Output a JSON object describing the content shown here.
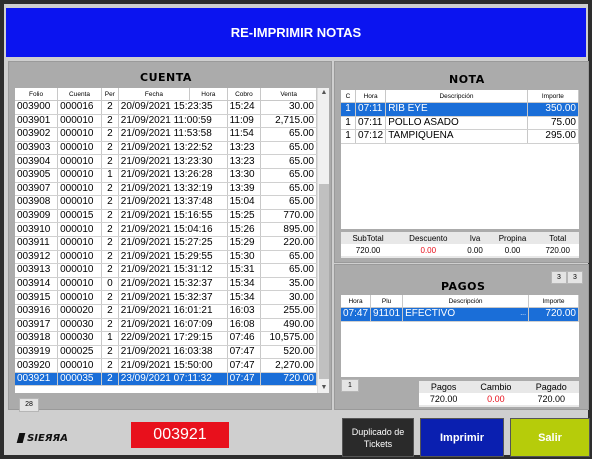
{
  "window": {
    "title": "RE-IMPRIMIR NOTAS"
  },
  "cuenta": {
    "title": "CUENTA",
    "columns": [
      "Folio",
      "Cuenta",
      "Per",
      "Fecha",
      "Hora",
      "Cobro",
      "Venta"
    ],
    "rows": [
      [
        "003900",
        "000016",
        "2",
        "20/09/2021 15:23:35",
        "15:24",
        "30.00"
      ],
      [
        "003901",
        "000010",
        "2",
        "21/09/2021 11:00:59",
        "11:09",
        "2,715.00"
      ],
      [
        "003902",
        "000010",
        "2",
        "21/09/2021 11:53:58",
        "11:54",
        "65.00"
      ],
      [
        "003903",
        "000010",
        "2",
        "21/09/2021 13:22:52",
        "13:23",
        "65.00"
      ],
      [
        "003904",
        "000010",
        "2",
        "21/09/2021 13:23:30",
        "13:23",
        "65.00"
      ],
      [
        "003905",
        "000010",
        "1",
        "21/09/2021 13:26:28",
        "13:30",
        "65.00"
      ],
      [
        "003907",
        "000010",
        "2",
        "21/09/2021 13:32:19",
        "13:39",
        "65.00"
      ],
      [
        "003908",
        "000010",
        "2",
        "21/09/2021 13:37:48",
        "15:04",
        "65.00"
      ],
      [
        "003909",
        "000015",
        "2",
        "21/09/2021 15:16:55",
        "15:25",
        "770.00"
      ],
      [
        "003910",
        "000010",
        "2",
        "21/09/2021 15:04:16",
        "15:26",
        "895.00"
      ],
      [
        "003911",
        "000010",
        "2",
        "21/09/2021 15:27:25",
        "15:29",
        "220.00"
      ],
      [
        "003912",
        "000010",
        "2",
        "21/09/2021 15:29:55",
        "15:30",
        "65.00"
      ],
      [
        "003913",
        "000010",
        "2",
        "21/09/2021 15:31:12",
        "15:31",
        "65.00"
      ],
      [
        "003914",
        "000010",
        "0",
        "21/09/2021 15:32:37",
        "15:34",
        "35.00"
      ],
      [
        "003915",
        "000010",
        "2",
        "21/09/2021 15:32:37",
        "15:34",
        "30.00"
      ],
      [
        "003916",
        "000020",
        "2",
        "21/09/2021 16:01:21",
        "16:03",
        "255.00"
      ],
      [
        "003917",
        "000030",
        "2",
        "21/09/2021 16:07:09",
        "16:08",
        "490.00"
      ],
      [
        "003918",
        "000030",
        "1",
        "22/09/2021 17:29:15",
        "07:46",
        "10,575.00"
      ],
      [
        "003919",
        "000025",
        "2",
        "21/09/2021 16:03:38",
        "07:47",
        "520.00"
      ],
      [
        "003920",
        "000010",
        "2",
        "21/09/2021 15:50:00",
        "07:47",
        "2,270.00"
      ],
      [
        "003921",
        "000035",
        "2",
        "23/09/2021 07:11:32",
        "07:47",
        "720.00"
      ]
    ],
    "selected_row": 20,
    "count": "28"
  },
  "nota": {
    "title": "NOTA",
    "columns": [
      "C",
      "Hora",
      "Descripción",
      "Importe"
    ],
    "rows": [
      [
        "1",
        "07:11",
        "RIB EYE",
        "350.00"
      ],
      [
        "1",
        "07:11",
        "POLLO ASADO",
        "75.00"
      ],
      [
        "1",
        "07:12",
        "TAMPIQUENA",
        "295.00"
      ]
    ],
    "selected_row": 0,
    "totals_labels": [
      "SubTotal",
      "Descuento",
      "Iva",
      "Propina",
      "Total"
    ],
    "totals_values": [
      "720.00",
      "0.00",
      "0.00",
      "0.00",
      "720.00"
    ]
  },
  "pagos": {
    "title": "PAGOS",
    "counter_a": "3",
    "counter_b": "3",
    "columns": [
      "Hora",
      "Plu",
      "Descripción",
      "Importe"
    ],
    "rows": [
      [
        "07:47",
        "91101",
        "EFECTIVO",
        "...",
        "720.00"
      ]
    ],
    "index": "1",
    "totals_labels": [
      "Pagos",
      "Cambio",
      "Pagado"
    ],
    "totals_values": [
      "720.00",
      "0.00",
      "720.00"
    ]
  },
  "footer": {
    "logo_text": "SIEЯЯA",
    "folio_display": "003921",
    "buttons": {
      "duplicado": "Duplicado de Tickets",
      "imprimir": "Imprimir",
      "salir": "Salir"
    }
  },
  "colors": {
    "title_bg": "#0b14f0",
    "selection": "#1a6ed8",
    "folio_red": "#e8101c",
    "salir_green": "#b6cc0a",
    "imprimir_blue": "#0a1fb0"
  }
}
